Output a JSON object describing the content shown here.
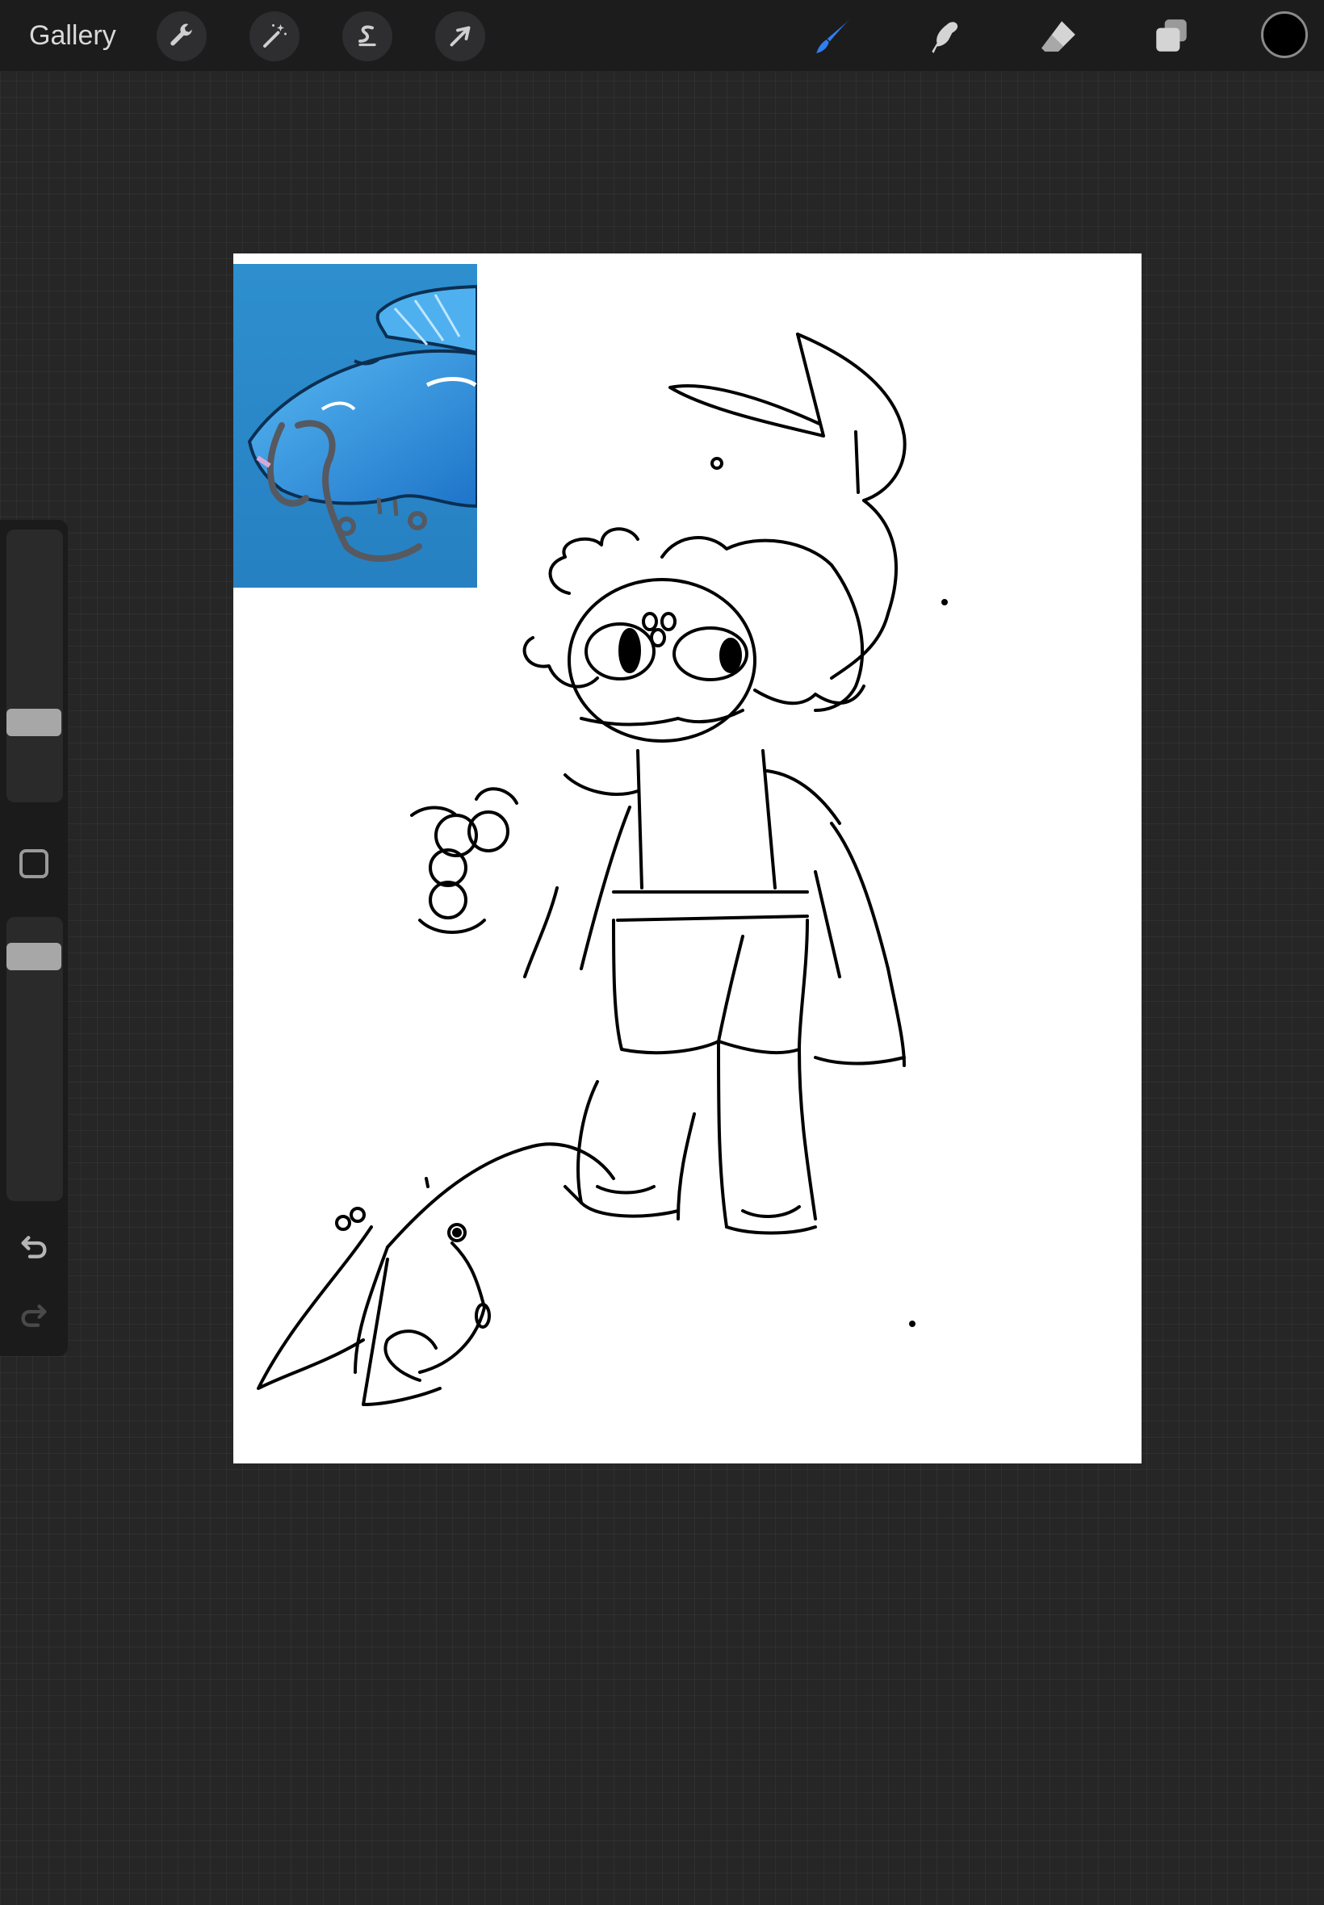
{
  "topbar": {
    "gallery_label": "Gallery",
    "left_tools": [
      {
        "name": "actions",
        "icon": "wrench-icon"
      },
      {
        "name": "adjustments",
        "icon": "magic-wand-icon"
      },
      {
        "name": "selection",
        "icon": "selection-s-icon"
      },
      {
        "name": "transform",
        "icon": "arrow-cursor-icon"
      }
    ],
    "right_tools": [
      {
        "name": "brush",
        "icon": "brush-icon",
        "active": true
      },
      {
        "name": "smudge",
        "icon": "smudge-finger-icon"
      },
      {
        "name": "eraser",
        "icon": "eraser-icon"
      },
      {
        "name": "layers",
        "icon": "layers-icon"
      }
    ],
    "current_color": "#000000",
    "active_color": "#2f7ff0"
  },
  "sidebar": {
    "brush_size_level": 0.27,
    "opacity_level": 0.9,
    "icons": [
      "modify-square-icon",
      "undo-icon",
      "redo-icon"
    ]
  },
  "colors": {
    "background": "#262627",
    "topbar": "#1c1c1d",
    "canvas": "#ffffff",
    "reference_blue": "#2e8fce"
  }
}
